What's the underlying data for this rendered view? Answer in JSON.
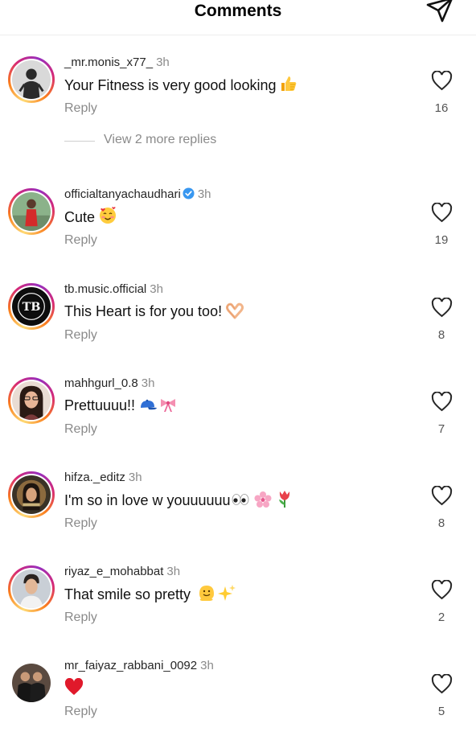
{
  "header": {
    "title": "Comments",
    "share_icon": "send-icon"
  },
  "view_replies_label": "View 2 more replies",
  "comments": [
    {
      "username": "_mr.monis_x77_",
      "time": "3h",
      "text": "Your Fitness is very good looking",
      "emoji": [
        "thumbs-up"
      ],
      "reply_label": "Reply",
      "likes": "16",
      "verified": false,
      "story_ring": true
    },
    {
      "username": "officialtanyachaudhari",
      "time": "3h",
      "text": "Cute",
      "emoji": [
        "smiling-face-with-hearts"
      ],
      "reply_label": "Reply",
      "likes": "19",
      "verified": true,
      "story_ring": true
    },
    {
      "username": "tb.music.official",
      "time": "3h",
      "text": "This Heart is for you too!",
      "emoji": [
        "heart-hands"
      ],
      "reply_label": "Reply",
      "likes": "8",
      "verified": false,
      "story_ring": true,
      "avatar_text": "TB"
    },
    {
      "username": "mahhgurl_0.8",
      "time": "3h",
      "text": "Prettuuuu!!",
      "emoji": [
        "blue-cap",
        "ribbon"
      ],
      "reply_label": "Reply",
      "likes": "7",
      "verified": false,
      "story_ring": true
    },
    {
      "username": "hifza._editz",
      "time": "3h",
      "text": "I'm so in love w youuuuuu",
      "emoji": [
        "eyes",
        "cherry-blossom",
        "tulip"
      ],
      "reply_label": "Reply",
      "likes": "8",
      "verified": false,
      "story_ring": true
    },
    {
      "username": "riyaz_e_mohabbat",
      "time": "3h",
      "text": "That smile so pretty",
      "emoji": [
        "melting-face",
        "sparkles"
      ],
      "reply_label": "Reply",
      "likes": "2",
      "verified": false,
      "story_ring": true
    },
    {
      "username": "mr_faiyaz_rabbani_0092",
      "time": "3h",
      "text": "",
      "emoji": [
        "red-heart"
      ],
      "reply_label": "Reply",
      "likes": "5",
      "verified": false,
      "story_ring": false
    }
  ],
  "colors": {
    "verified": "#3897f0",
    "meta_gray": "#8a8a8a",
    "ring_start": "#feda75",
    "ring_end": "#962fbf"
  }
}
